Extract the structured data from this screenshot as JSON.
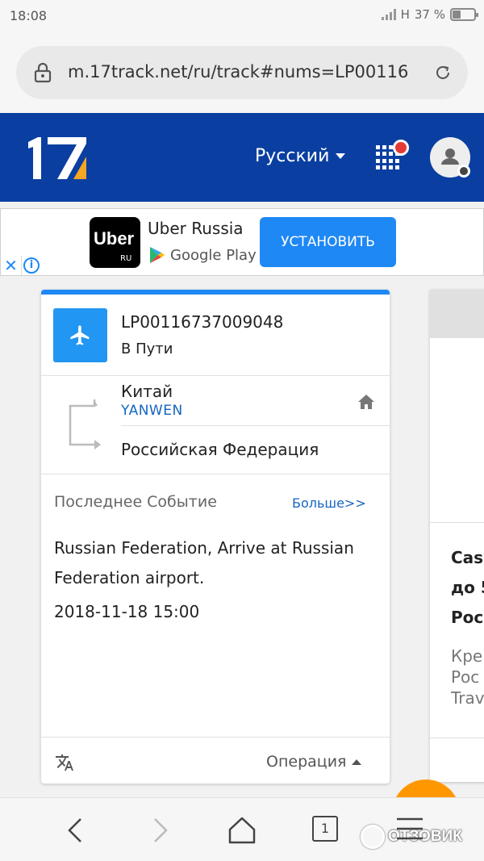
{
  "status_bar": {
    "time": "18:08",
    "network": "H",
    "battery": "37 %"
  },
  "browser": {
    "url": "m.17track.net/ru/track#nums=LP00116"
  },
  "header": {
    "logo": "17",
    "language": "Русский"
  },
  "ad": {
    "brand": "Uber",
    "brand_sub": "RU",
    "title": "Uber Russia",
    "store": "Google Play",
    "install_label": "УСТАНОВИТЬ",
    "close": "✕",
    "info": "i"
  },
  "card": {
    "tracking_number": "LP00116737009048",
    "status": "В Пути",
    "origin": "Китай",
    "carrier": "YANWEN",
    "destination": "Российская Федерация",
    "last_event_label": "Последнее Событие",
    "more_label": "Больше>>",
    "event_text": "Russian Federation, Arrive at Russian Federation airport.",
    "event_date": "2018-11-18 15:00",
    "operation_label": "Операция"
  },
  "side_card": {
    "line1": "Cas",
    "line2": "до 5",
    "line3": "Рос",
    "line4": "Кре",
    "line5": "Рос",
    "line6": "Trav"
  },
  "nav": {
    "tab_count": "1",
    "watermark": "ОТЗОВИК"
  },
  "colors": {
    "header_bg": "#0a3fa1",
    "accent": "#1e88f5",
    "logo_orange": "#f6a623"
  }
}
